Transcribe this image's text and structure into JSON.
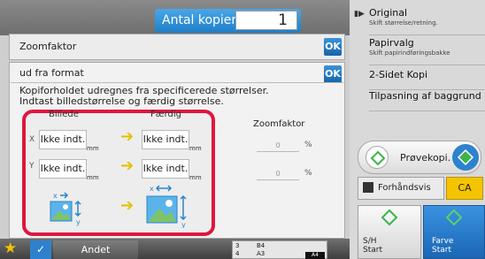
{
  "header": {
    "copies_label": "Antal kopier",
    "copies_value": "1"
  },
  "dialog_zoom": {
    "title": "Zoomfaktor",
    "ok_label": "OK"
  },
  "dialog_format": {
    "title": "ud fra format",
    "ok_label": "OK",
    "desc_line1": "Kopiforholdet udregnes fra specificerede størrelser.",
    "desc_line2": "Indtast billedstørrelse og færdig størrelse."
  },
  "size_panel": {
    "col_original": "Billede",
    "col_finished": "Færdig",
    "axis_x": "X",
    "axis_y": "Y",
    "x_original": "Ikke indt.",
    "x_finished": "Ikke indt.",
    "y_original": "Ikke indt.",
    "y_finished": "Ikke indt.",
    "unit": "mm"
  },
  "zoom": {
    "header": "Zoomfaktor",
    "x_value": "0",
    "y_value": "0",
    "unit": "%"
  },
  "right_panel": {
    "items": [
      {
        "title": "Original",
        "subtitle": "Skift størrelse/retning."
      },
      {
        "title": "Papirvalg",
        "subtitle": "Skift papirindføringsbakke"
      },
      {
        "title": "2-Sidet Kopi",
        "subtitle": ""
      },
      {
        "title": "Tilpasning af baggrund",
        "subtitle": ""
      }
    ],
    "preview_label": "Prøvekopi.",
    "preview_screen_label": "Forhåndsvis",
    "ca_label": "CA",
    "bw_start": "S/H\nStart",
    "bw_start_line1": "S/H",
    "bw_start_line2": "Start",
    "color_start_line1": "Farve",
    "color_start_line2": "Start"
  },
  "bottom": {
    "other_label": "Andet",
    "tray_rows": [
      {
        "num": "3",
        "size": "B4"
      },
      {
        "num": "4",
        "size": "A3"
      }
    ],
    "paper_badge": "A4"
  },
  "colors": {
    "accent_blue": "#1f7fc7",
    "highlight_red": "#e0163f",
    "arrow_yellow": "#e3c200",
    "start_green": "#3bb54a"
  }
}
